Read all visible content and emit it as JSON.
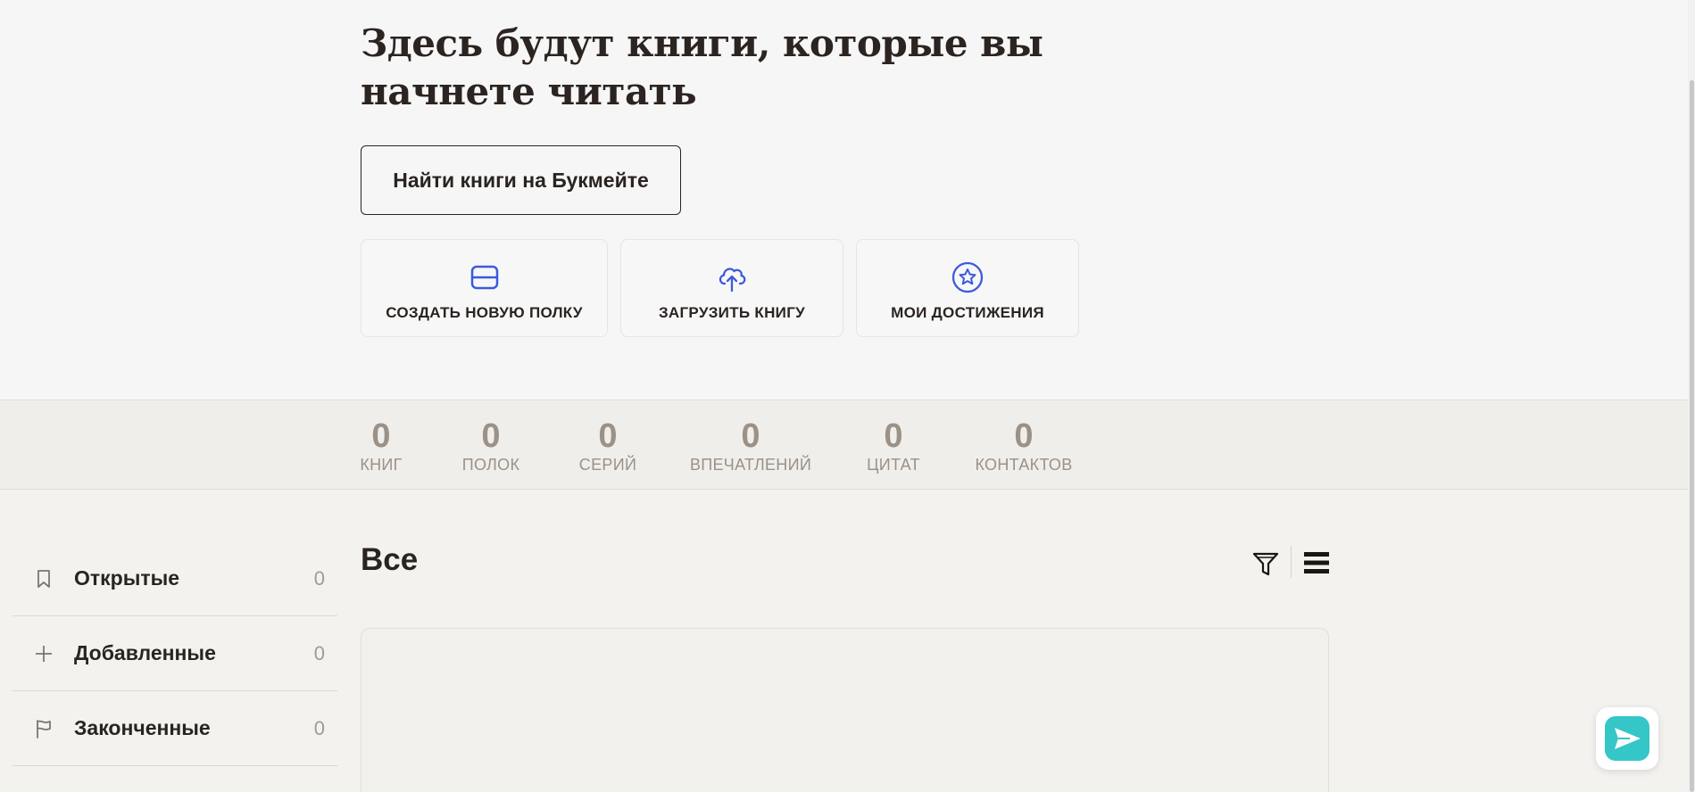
{
  "header": {
    "title": "Здесь будут книги, которые вы начнете читать",
    "find_button_label": "Найти книги на Букмейте"
  },
  "actions": [
    {
      "label": "СОЗДАТЬ НОВУЮ ПОЛКУ",
      "icon": "card-icon"
    },
    {
      "label": "ЗАГРУЗИТЬ КНИГУ",
      "icon": "cloud-upload-icon"
    },
    {
      "label": "МОИ ДОСТИЖЕНИЯ",
      "icon": "star-circle-icon"
    }
  ],
  "stats": [
    {
      "value": "0",
      "label": "КНИГ"
    },
    {
      "value": "0",
      "label": "ПОЛОК"
    },
    {
      "value": "0",
      "label": "СЕРИЙ"
    },
    {
      "value": "0",
      "label": "ВПЕЧАТЛЕНИЙ"
    },
    {
      "value": "0",
      "label": "ЦИТАТ"
    },
    {
      "value": "0",
      "label": "КОНТАКТОВ"
    }
  ],
  "sidebar": {
    "items": [
      {
        "label": "Открытые",
        "count": "0",
        "icon": "bookmark-icon"
      },
      {
        "label": "Добавленные",
        "count": "0",
        "icon": "plus-icon"
      },
      {
        "label": "Законченные",
        "count": "0",
        "icon": "flag-icon"
      }
    ]
  },
  "main": {
    "section_title": "Все"
  },
  "colors": {
    "accent": "#3b5bdb",
    "text": "#2a2420",
    "muted": "#9b9187",
    "chat": "#35c6c8"
  }
}
